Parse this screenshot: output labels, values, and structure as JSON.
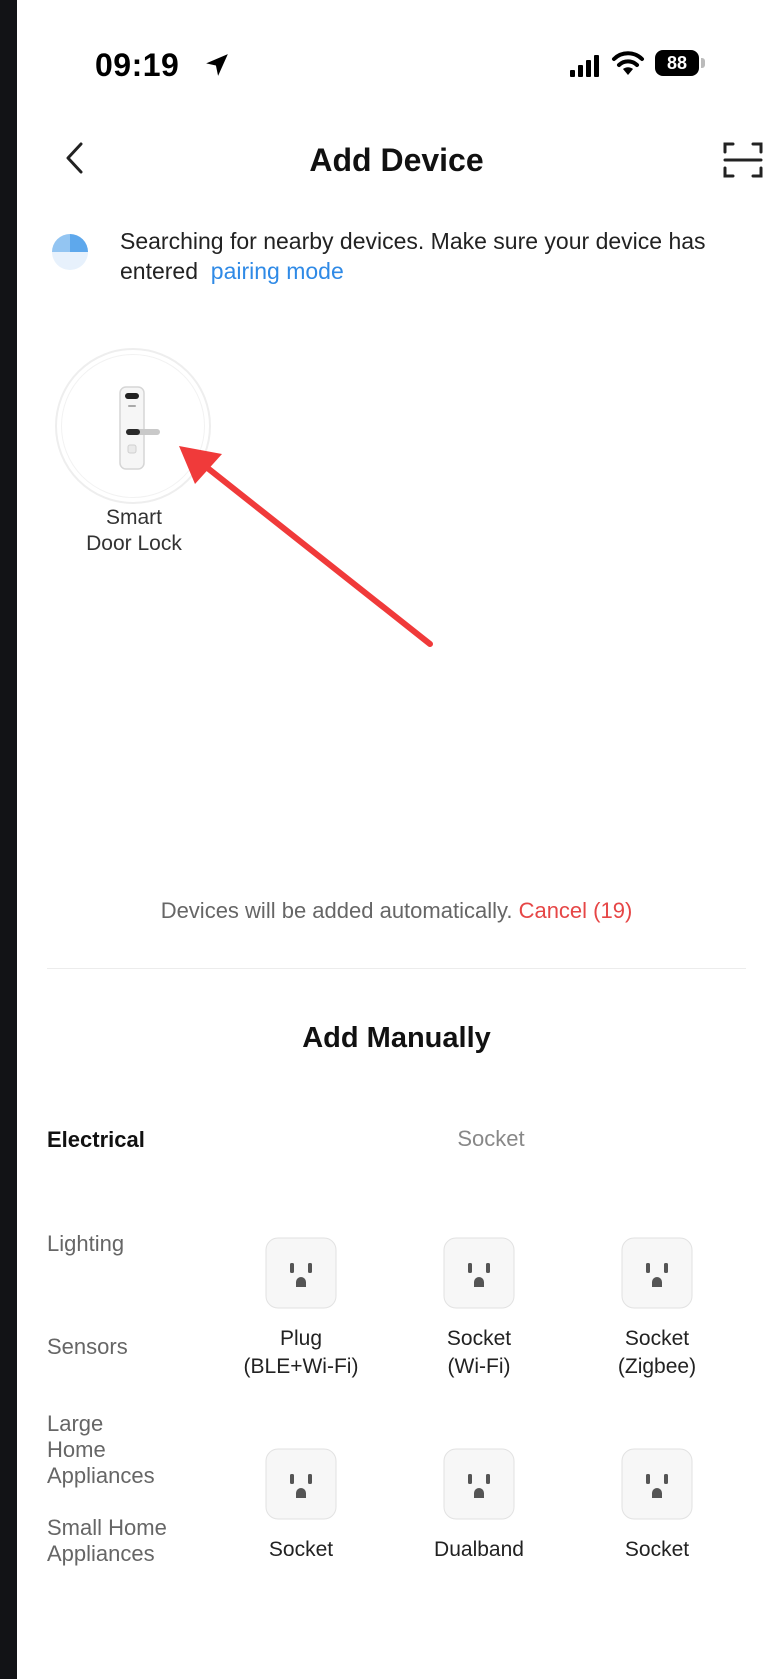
{
  "status_bar": {
    "time": "09:19",
    "battery": "88"
  },
  "nav": {
    "title": "Add Device"
  },
  "search": {
    "message": "Searching for nearby devices. Make sure your device has entered",
    "link": "pairing mode"
  },
  "found_devices": [
    {
      "name_line1": "Smart",
      "name_line2": "Door Lock"
    }
  ],
  "auto_add": {
    "message": "Devices will be added automatically.",
    "cancel": "Cancel (19)"
  },
  "manual": {
    "title": "Add Manually",
    "categories": [
      "Electrical",
      "Lighting",
      "Sensors",
      "Large Home Appliances",
      "Small Home Appliances"
    ],
    "active_category": "Electrical",
    "section": "Socket",
    "devices": [
      {
        "line1": "Plug",
        "line2": "(BLE+Wi-Fi)"
      },
      {
        "line1": "Socket",
        "line2": "(Wi-Fi)"
      },
      {
        "line1": "Socket",
        "line2": "(Zigbee)"
      },
      {
        "line1": "Socket",
        "line2": ""
      },
      {
        "line1": "Dualband",
        "line2": ""
      },
      {
        "line1": "Socket",
        "line2": ""
      }
    ]
  },
  "colors": {
    "link": "#2f8ae6",
    "cancel": "#e64646",
    "annotation_arrow": "#f03a3a"
  },
  "icons": [
    "location-arrow-icon",
    "cellular-signal-icon",
    "wifi-icon",
    "back-chevron-icon",
    "scan-icon",
    "loading-spinner-icon",
    "door-lock-icon",
    "outlet-icon"
  ]
}
